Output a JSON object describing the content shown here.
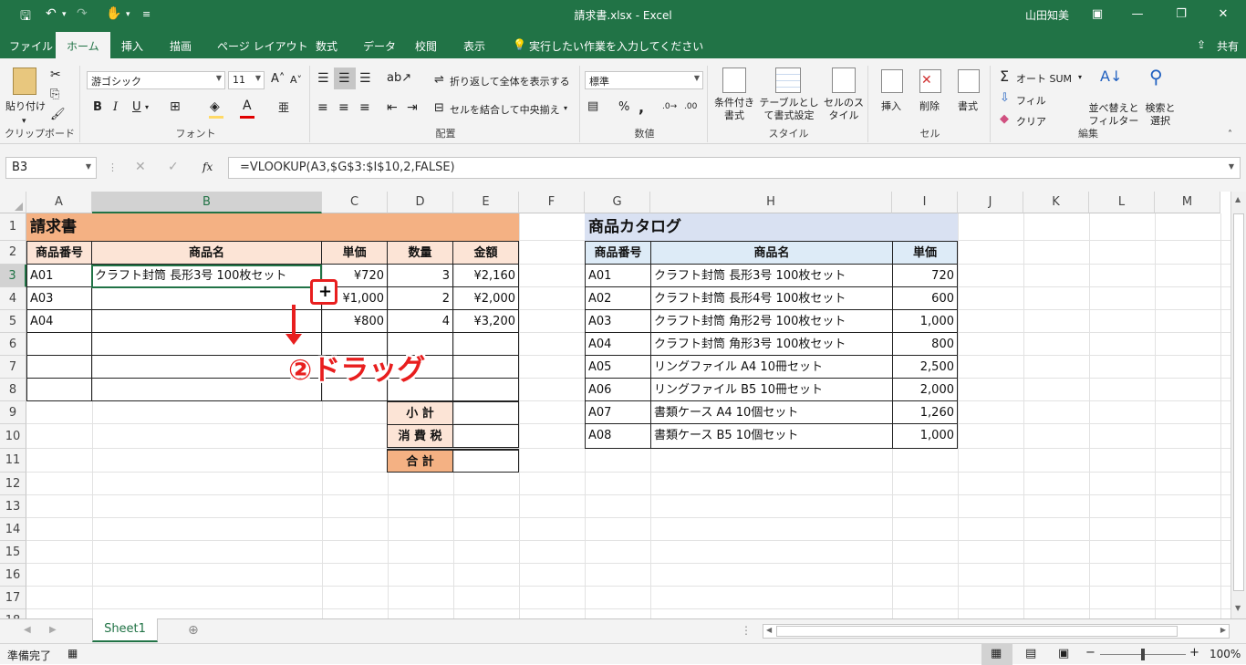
{
  "window": {
    "title": "請求書.xlsx  -  Excel",
    "user": "山田知美"
  },
  "tabs": [
    "ファイル",
    "ホーム",
    "挿入",
    "描画",
    "ページ レイアウト",
    "数式",
    "データ",
    "校閲",
    "表示"
  ],
  "tell_me": "実行したい作業を入力してください",
  "share": "共有",
  "ribbon": {
    "clipboard": {
      "paste": "貼り付け",
      "label": "クリップボード"
    },
    "font": {
      "name": "游ゴシック",
      "size": "11",
      "bold": "B",
      "italic": "I",
      "underline": "U",
      "label": "フォント"
    },
    "alignment": {
      "wrap": "折り返して全体を表示する",
      "merge": "セルを結合して中央揃え",
      "label": "配置"
    },
    "number": {
      "format": "標準",
      "percent": "%",
      "comma": ",",
      "label": "数値"
    },
    "styles": {
      "conditional": "条件付き書式",
      "table": "テーブルとして書式設定",
      "cell": "セルのスタイル",
      "label": "スタイル"
    },
    "cells": {
      "insert": "挿入",
      "delete": "削除",
      "format": "書式",
      "label": "セル"
    },
    "editing": {
      "autosum": "オート SUM",
      "fill": "フィル",
      "clear": "クリア",
      "sort": "並べ替えとフィルター",
      "find": "検索と選択",
      "label": "編集"
    }
  },
  "formula_bar": {
    "name_box": "B3",
    "formula": "=VLOOKUP(A3,$G$3:$I$10,2,FALSE)"
  },
  "columns": [
    "A",
    "B",
    "C",
    "D",
    "E",
    "F",
    "G",
    "H",
    "I",
    "J",
    "K",
    "L",
    "M"
  ],
  "rows": [
    "1",
    "2",
    "3",
    "4",
    "5",
    "6",
    "7",
    "8",
    "9",
    "10",
    "11",
    "12",
    "13",
    "14",
    "15",
    "16",
    "17",
    "18"
  ],
  "invoice": {
    "title": "請求書",
    "headers": [
      "商品番号",
      "商品名",
      "単価",
      "数量",
      "金額"
    ],
    "rows": [
      [
        "A01",
        "クラフト封筒 長形3号 100枚セット",
        "¥720",
        "3",
        "¥2,160"
      ],
      [
        "A03",
        "",
        "¥1,000",
        "2",
        "¥2,000"
      ],
      [
        "A04",
        "",
        "¥800",
        "4",
        "¥3,200"
      ]
    ],
    "subtotal": "小 計",
    "tax": "消 費 税",
    "total": "合 計"
  },
  "catalog": {
    "title": "商品カタログ",
    "headers": [
      "商品番号",
      "商品名",
      "単価"
    ],
    "rows": [
      [
        "A01",
        "クラフト封筒 長形3号 100枚セット",
        "720"
      ],
      [
        "A02",
        "クラフト封筒 長形4号 100枚セット",
        "600"
      ],
      [
        "A03",
        "クラフト封筒 角形2号 100枚セット",
        "1,000"
      ],
      [
        "A04",
        "クラフト封筒 角形3号 100枚セット",
        "800"
      ],
      [
        "A05",
        "リングファイル A4 10冊セット",
        "2,500"
      ],
      [
        "A06",
        "リングファイル B5 10冊セット",
        "2,000"
      ],
      [
        "A07",
        "書類ケース A4 10個セット",
        "1,260"
      ],
      [
        "A08",
        "書類ケース B5 10個セット",
        "1,000"
      ]
    ]
  },
  "annotation": "②ドラッグ",
  "sheet_tab": "Sheet1",
  "status": {
    "ready": "準備完了",
    "zoom": "100%"
  },
  "colors": {
    "accent": "#217346",
    "invoice_title_bg": "#f4b183",
    "invoice_header_bg": "#fce4d6",
    "catalog_title_bg": "#d9e1f2",
    "catalog_header_bg": "#ddebf7",
    "annotation": "#e81e1e"
  }
}
